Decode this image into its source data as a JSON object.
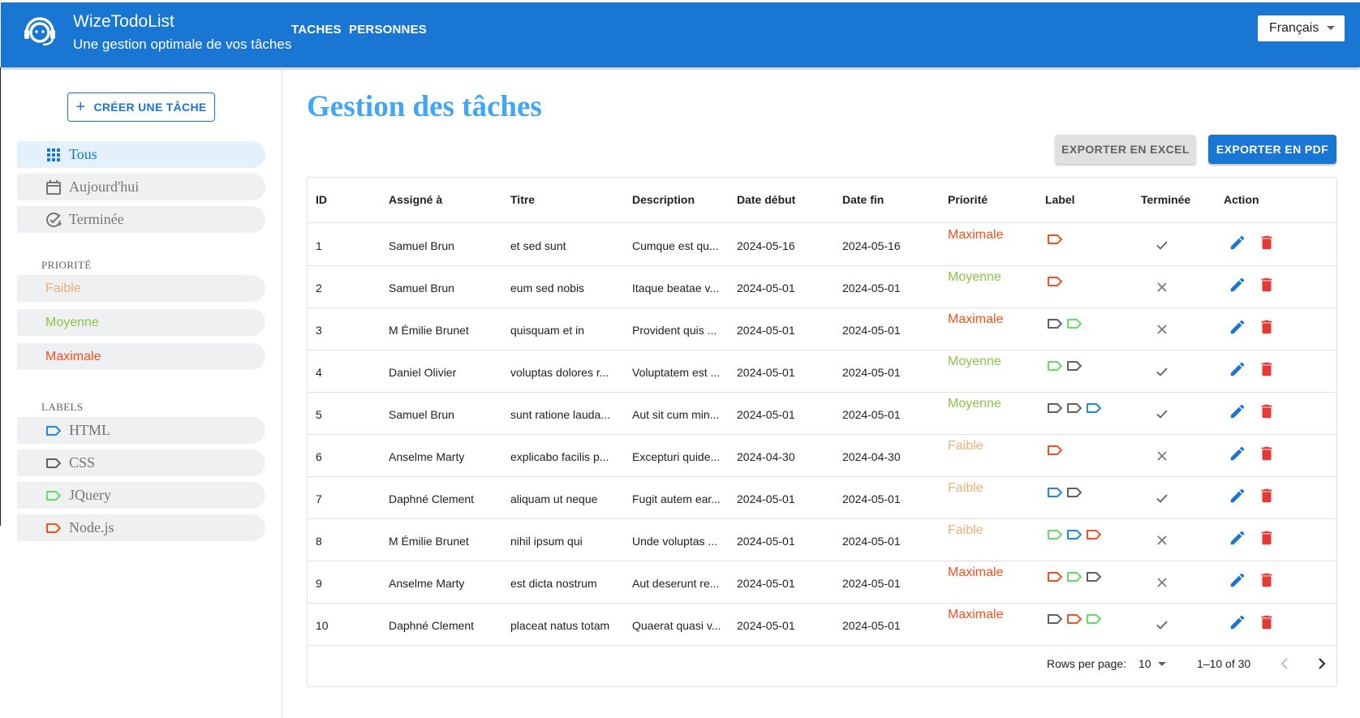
{
  "app": {
    "title": "WizeTodoList",
    "subtitle": "Une gestion optimale de vos tâches",
    "nav": [
      "TACHES",
      "PERSONNES"
    ],
    "language": "Français"
  },
  "sidebar": {
    "create_label": "CRÉER UNE TÂCHE",
    "filters": [
      {
        "label": "Tous",
        "icon": "grid-icon",
        "active": true
      },
      {
        "label": "Aujourd'hui",
        "icon": "calendar-icon",
        "active": false
      },
      {
        "label": "Terminée",
        "icon": "check-badge-icon",
        "active": false
      }
    ],
    "priority_heading": "PRIORITÉ",
    "priorities": [
      {
        "label": "Faible",
        "color": "#e8b07a"
      },
      {
        "label": "Moyenne",
        "color": "#8bc34a"
      },
      {
        "label": "Maximale",
        "color": "#f4511e"
      }
    ],
    "labels_heading": "LABELS",
    "labels": [
      {
        "label": "HTML",
        "color": "#1e88e5"
      },
      {
        "label": "CSS",
        "color": "#616161"
      },
      {
        "label": "JQuery",
        "color": "#66dd66"
      },
      {
        "label": "Node.js",
        "color": "#f4511e"
      }
    ]
  },
  "main": {
    "title": "Gestion des tâches",
    "export_excel": "EXPORTER EN EXCEL",
    "export_pdf": "EXPORTER EN PDF"
  },
  "colors": {
    "primary": "#1976d2",
    "title": "#42a5f5",
    "delete": "#e53935",
    "Faible": "#e8b07a",
    "Moyenne": "#8bc34a",
    "Maximale": "#f4511e",
    "HTML": "#1e88e5",
    "CSS": "#616161",
    "JQuery": "#66dd66",
    "Node.js": "#f4511e"
  },
  "table": {
    "columns": [
      "ID",
      "Assigné à",
      "Titre",
      "Description",
      "Date début",
      "Date fin",
      "Priorité",
      "Label",
      "Terminée",
      "Action"
    ],
    "rows": [
      {
        "id": "1",
        "assignee": "Samuel Brun",
        "title": "et sed sunt",
        "description": "Cumque est qu...",
        "start": "2024-05-16",
        "end": "2024-05-16",
        "priority": "Maximale",
        "labels": [
          "Node.js"
        ],
        "done": true
      },
      {
        "id": "2",
        "assignee": "Samuel Brun",
        "title": "eum sed nobis",
        "description": "Itaque beatae v...",
        "start": "2024-05-01",
        "end": "2024-05-01",
        "priority": "Moyenne",
        "labels": [
          "Node.js"
        ],
        "done": false
      },
      {
        "id": "3",
        "assignee": "M Émilie Brunet",
        "title": "quisquam et in",
        "description": "Provident quis ...",
        "start": "2024-05-01",
        "end": "2024-05-01",
        "priority": "Maximale",
        "labels": [
          "CSS",
          "JQuery"
        ],
        "done": false
      },
      {
        "id": "4",
        "assignee": "Daniel Olivier",
        "title": "voluptas dolores r...",
        "description": "Voluptatem est ...",
        "start": "2024-05-01",
        "end": "2024-05-01",
        "priority": "Moyenne",
        "labels": [
          "JQuery",
          "CSS"
        ],
        "done": true
      },
      {
        "id": "5",
        "assignee": "Samuel Brun",
        "title": "sunt ratione lauda...",
        "description": "Aut sit cum min...",
        "start": "2024-05-01",
        "end": "2024-05-01",
        "priority": "Moyenne",
        "labels": [
          "CSS",
          "CSS",
          "HTML"
        ],
        "done": true
      },
      {
        "id": "6",
        "assignee": "Anselme Marty",
        "title": "explicabo facilis p...",
        "description": "Excepturi quide...",
        "start": "2024-04-30",
        "end": "2024-04-30",
        "priority": "Faible",
        "labels": [
          "Node.js"
        ],
        "done": false
      },
      {
        "id": "7",
        "assignee": "Daphné Clement",
        "title": "aliquam ut neque",
        "description": "Fugit autem ear...",
        "start": "2024-05-01",
        "end": "2024-05-01",
        "priority": "Faible",
        "labels": [
          "HTML",
          "CSS"
        ],
        "done": true
      },
      {
        "id": "8",
        "assignee": "M Émilie Brunet",
        "title": "nihil ipsum qui",
        "description": "Unde voluptas ...",
        "start": "2024-05-01",
        "end": "2024-05-01",
        "priority": "Faible",
        "labels": [
          "JQuery",
          "HTML",
          "Node.js"
        ],
        "done": false
      },
      {
        "id": "9",
        "assignee": "Anselme Marty",
        "title": "est dicta nostrum",
        "description": "Aut deserunt re...",
        "start": "2024-05-01",
        "end": "2024-05-01",
        "priority": "Maximale",
        "labels": [
          "Node.js",
          "JQuery",
          "CSS"
        ],
        "done": false
      },
      {
        "id": "10",
        "assignee": "Daphné Clement",
        "title": "placeat natus totam",
        "description": "Quaerat quasi v...",
        "start": "2024-05-01",
        "end": "2024-05-01",
        "priority": "Maximale",
        "labels": [
          "CSS",
          "Node.js",
          "JQuery"
        ],
        "done": true
      }
    ],
    "footer": {
      "rows_per_page_label": "Rows per page:",
      "rows_per_page": "10",
      "range": "1–10 of 30"
    }
  }
}
